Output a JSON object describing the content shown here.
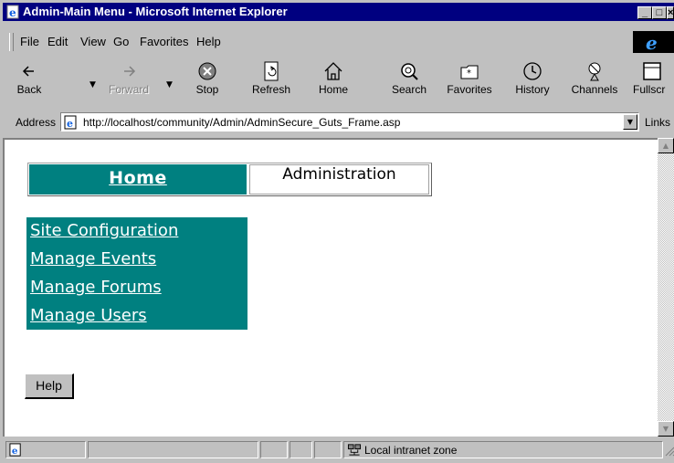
{
  "window": {
    "title": "Admin-Main Menu - Microsoft Internet Explorer"
  },
  "menu": [
    "File",
    "Edit",
    "View",
    "Go",
    "Favorites",
    "Help"
  ],
  "toolbar": {
    "back": "Back",
    "forward": "Forward",
    "stop": "Stop",
    "refresh": "Refresh",
    "home": "Home",
    "search": "Search",
    "favorites": "Favorites",
    "history": "History",
    "channels": "Channels",
    "fullscreen": "Fullscr"
  },
  "address": {
    "label": "Address",
    "url": "http://localhost/community/Admin/AdminSecure_Guts_Frame.asp",
    "links": "Links"
  },
  "page": {
    "nav": {
      "home": "Home",
      "current": "Administration"
    },
    "links": [
      "Site Configuration",
      "Manage Events",
      "Manage Forums",
      "Manage Users"
    ],
    "help_button": "Help"
  },
  "status": {
    "zone": "Local intranet zone"
  },
  "colors": {
    "title_bar": "#000080",
    "teal": "#008080",
    "chrome": "#c0c0c0"
  }
}
